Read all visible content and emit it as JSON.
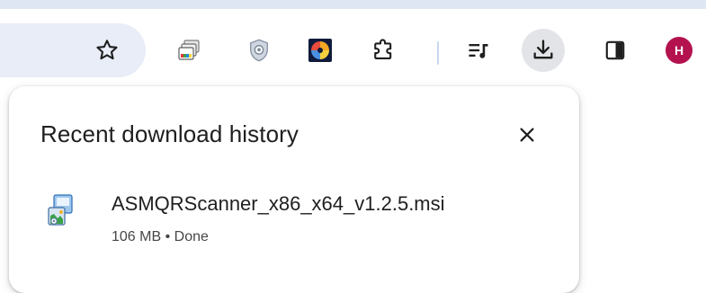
{
  "toolbar": {
    "icons": [
      "star-icon",
      "tab-groups-icon",
      "shield-extension-icon",
      "color-extension-icon",
      "extensions-puzzle-icon",
      "reading-list-icon",
      "download-icon",
      "side-panel-icon"
    ],
    "profile_initial": "H",
    "profile_color": "#b3124f"
  },
  "download_bubble": {
    "title": "Recent download history",
    "close_icon": "close-icon",
    "items": [
      {
        "file_name": "ASMQRScanner_x86_x64_v1.2.5.msi",
        "status": "106 MB • Done",
        "icon": "msi-installer-icon"
      }
    ]
  },
  "colors": {
    "accent": "#1a73e8",
    "text_primary": "#1f1f1f",
    "text_secondary": "#474747"
  }
}
